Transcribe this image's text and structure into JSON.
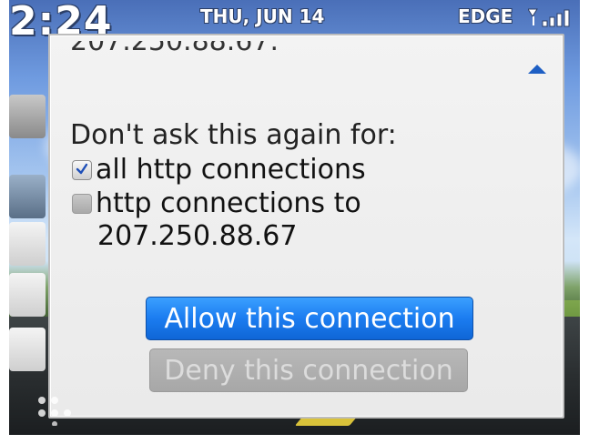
{
  "status_bar": {
    "time": "2:24",
    "date": "THU, JUN 14",
    "network": "EDGE"
  },
  "dialog": {
    "cut_off_text": "207.250.88.67.",
    "prompt": "Don't ask this again for:",
    "options": [
      {
        "label": "all http connections",
        "checked": true
      },
      {
        "label": "http connections to",
        "checked": false
      }
    ],
    "host": "207.250.88.67",
    "allow_label": "Allow this connection",
    "deny_label": "Deny this connection"
  },
  "colors": {
    "allow_button": "#1b7cf0",
    "deny_button": "#a7a7a7",
    "scroll_arrow": "#1e5fc4"
  },
  "icons": [
    "scroll-up-arrow-icon",
    "checkbox-checked-icon",
    "checkbox-unchecked-icon",
    "signal-strength-icon",
    "app-switcher-icon"
  ]
}
